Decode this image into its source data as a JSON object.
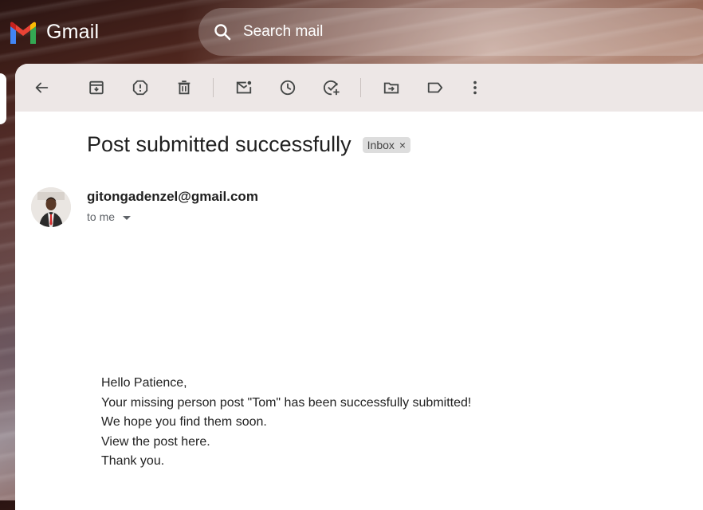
{
  "app": {
    "name": "Gmail"
  },
  "search": {
    "placeholder": "Search mail"
  },
  "toolbar": {
    "buttons": [
      {
        "icon": "back-arrow-icon"
      },
      {
        "icon": "archive-icon"
      },
      {
        "icon": "report-spam-icon"
      },
      {
        "icon": "delete-icon"
      },
      {
        "icon": "mark-unread-icon"
      },
      {
        "icon": "snooze-icon"
      },
      {
        "icon": "add-to-tasks-icon"
      },
      {
        "icon": "move-to-icon"
      },
      {
        "icon": "label-icon"
      },
      {
        "icon": "more-vert-icon"
      }
    ]
  },
  "email": {
    "subject": "Post submitted successfully",
    "label": "Inbox",
    "label_remove": "×",
    "sender": "gitongadenzel@gmail.com",
    "recipient": "to me",
    "body": [
      "Hello Patience,",
      "Your missing person post \"Tom\" has been successfully submitted!",
      "We hope you find them soon.",
      "View the post here.",
      "Thank you."
    ]
  },
  "colors": {
    "logo_red": "#ea4335",
    "logo_blue": "#4285f4",
    "logo_green": "#34a853",
    "logo_yellow": "#fbbc04",
    "icon_gray": "#444746"
  }
}
